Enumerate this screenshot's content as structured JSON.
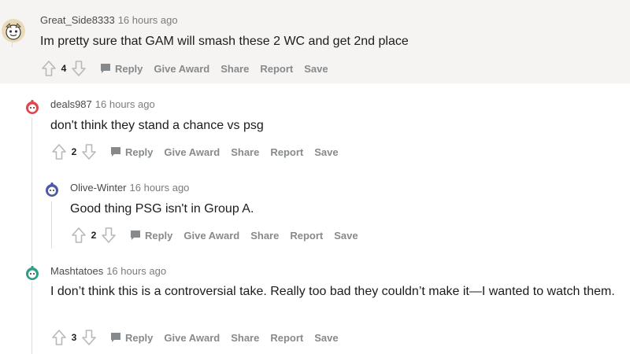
{
  "actions": {
    "reply": "Reply",
    "give_award": "Give Award",
    "share": "Share",
    "report": "Report",
    "save": "Save"
  },
  "colors": {
    "highlight_bg": "#f6f4f2",
    "action_text": "#878a8c",
    "vote_arrow": "#b8b8b8"
  },
  "comments": [
    {
      "username": "Great_Side8333",
      "time": "16 hours ago",
      "text": "Im pretty sure that GAM will smash these 2 WC and get 2nd place",
      "score": "4",
      "avatar_icon": "snoo-avatar-icon"
    },
    {
      "username": "deals987",
      "time": "16 hours ago",
      "text": "don't think they stand a chance vs psg",
      "score": "2",
      "avatar_icon": "snoo-avatar-icon"
    },
    {
      "username": "Olive-Winter",
      "time": "16 hours ago",
      "text": "Good thing PSG isn't in Group A.",
      "score": "2",
      "avatar_icon": "snoo-avatar-icon"
    },
    {
      "username": "Mashtatoes",
      "time": "16 hours ago",
      "text": "I don’t think this is a controversial take. Really too bad they couldn’t make it—I wanted to watch them.",
      "score": "3",
      "avatar_icon": "snoo-avatar-icon"
    }
  ]
}
